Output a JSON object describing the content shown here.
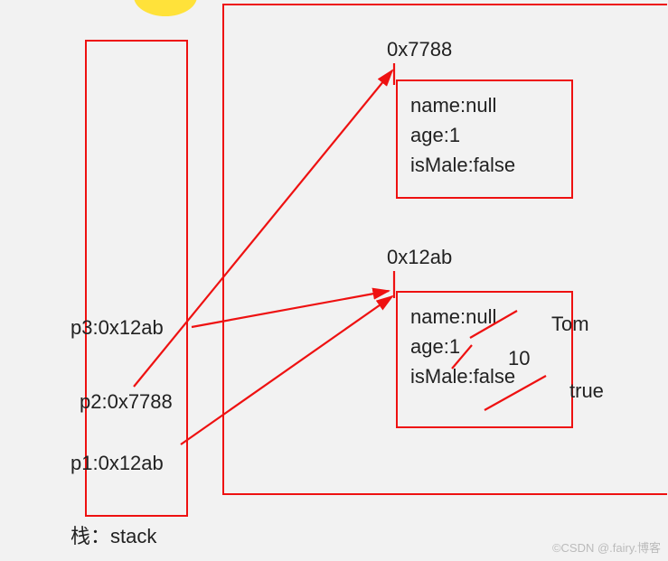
{
  "stack": {
    "label": "栈：stack",
    "entries": {
      "p3": "p3:0x12ab",
      "p2": "p2:0x7788",
      "p1": "p1:0x12ab"
    }
  },
  "heap": {
    "obj1": {
      "address": "0x7788",
      "fields": {
        "name": "name:null",
        "age": "age:1",
        "isMale": "isMale:false"
      }
    },
    "obj2": {
      "address": "0x12ab",
      "fields": {
        "name": "name:null",
        "age": "age:1",
        "isMale": "isMale:false"
      },
      "edits": {
        "name": "Tom",
        "age": "10",
        "isMale": "true"
      }
    }
  },
  "watermark": "©CSDN @.fairy.博客"
}
